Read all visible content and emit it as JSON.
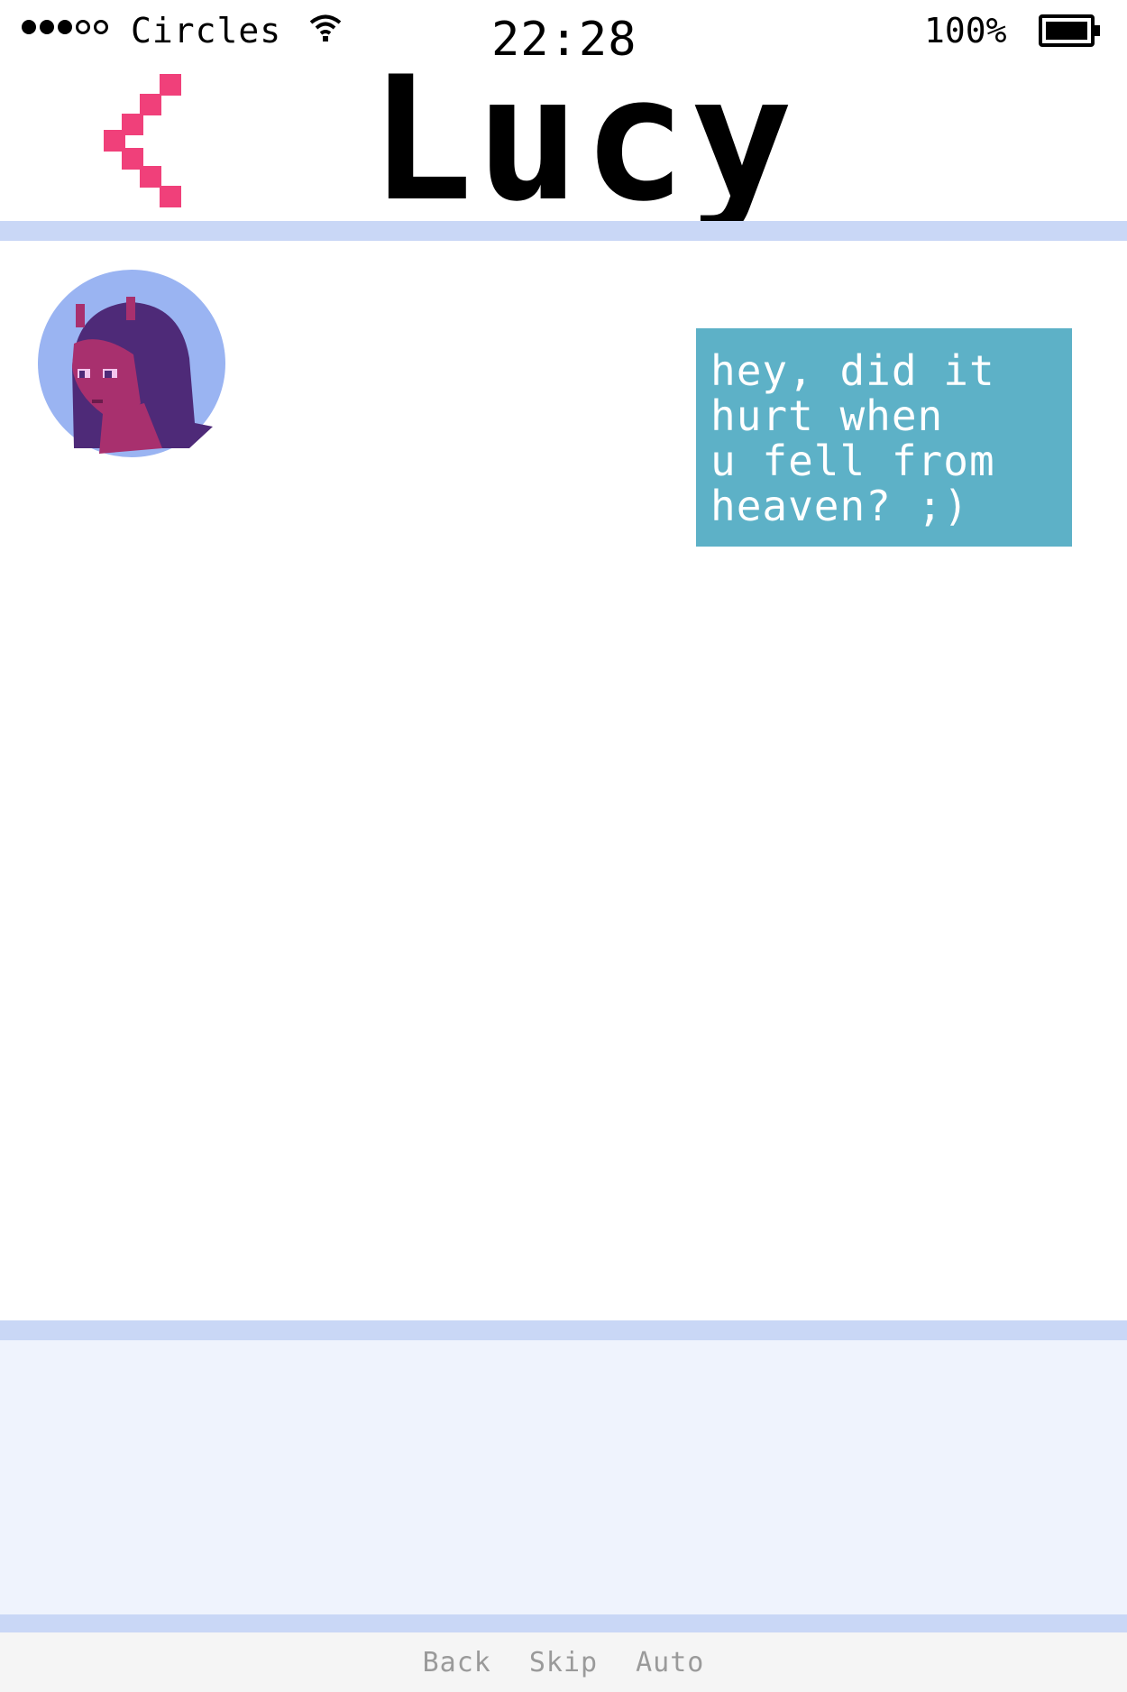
{
  "status_bar": {
    "signal_filled": 3,
    "signal_total": 5,
    "carrier": "Circles",
    "time": "22:28",
    "battery_percent": "100%",
    "battery_level": 1.0
  },
  "header": {
    "back_icon": "chevron-left-icon",
    "contact_name": "Lucy"
  },
  "chat": {
    "avatar_icon": "avatar-portrait-icon",
    "messages": [
      {
        "sender": "player",
        "text": "hey, did it\nhurt when\nu fell from\nheaven? ;)"
      }
    ]
  },
  "quick_menu": {
    "back_label": "Back",
    "skip_label": "Skip",
    "auto_label": "Auto"
  },
  "colors": {
    "accent_pink": "#f0407a",
    "bubble": "#5db1c7",
    "divider": "#c9d7f6",
    "panel": "#eff3fd",
    "avatar_bg": "#9ab4f2",
    "hair": "#4e2a78",
    "skin": "#a8306e"
  }
}
